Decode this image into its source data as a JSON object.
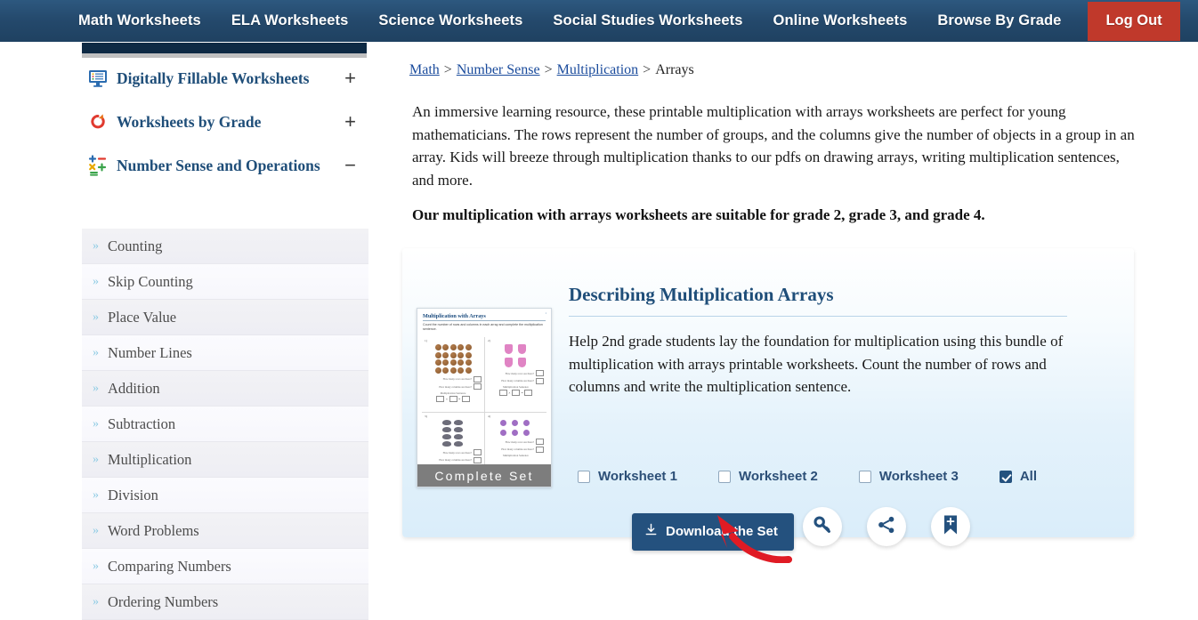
{
  "topnav": {
    "items": [
      {
        "label": "Math Worksheets",
        "name": "nav-math-worksheets"
      },
      {
        "label": "ELA Worksheets",
        "name": "nav-ela-worksheets"
      },
      {
        "label": "Science Worksheets",
        "name": "nav-science-worksheets"
      },
      {
        "label": "Social Studies Worksheets",
        "name": "nav-social-studies-worksheets"
      },
      {
        "label": "Online Worksheets",
        "name": "nav-online-worksheets"
      },
      {
        "label": "Browse By Grade",
        "name": "nav-browse-by-grade"
      }
    ],
    "logout_label": "Log Out",
    "bg_color": "#24496c",
    "logout_color": "#c0392b"
  },
  "sidebar": {
    "categories": [
      {
        "label": "Digitally Fillable Worksheets",
        "toggle": "+",
        "icon": "monitor-worksheet-icon",
        "expanded": false
      },
      {
        "label": "Worksheets by Grade",
        "toggle": "+",
        "icon": "refresh-circle-icon",
        "expanded": false
      },
      {
        "label": "Number Sense and Operations",
        "toggle": "−",
        "icon": "math-operations-icon",
        "expanded": true
      }
    ],
    "items": [
      {
        "label": "Counting"
      },
      {
        "label": "Skip Counting"
      },
      {
        "label": "Place Value"
      },
      {
        "label": "Number Lines"
      },
      {
        "label": "Addition"
      },
      {
        "label": "Subtraction"
      },
      {
        "label": "Multiplication"
      },
      {
        "label": "Division"
      },
      {
        "label": "Word Problems"
      },
      {
        "label": "Comparing Numbers"
      },
      {
        "label": "Ordering Numbers"
      }
    ],
    "bullet": "»",
    "link_color": "#1f4e79"
  },
  "breadcrumb": {
    "items": [
      {
        "label": "Math",
        "link": true
      },
      {
        "label": "Number Sense",
        "link": true
      },
      {
        "label": "Multiplication",
        "link": true
      },
      {
        "label": "Arrays",
        "link": false
      }
    ],
    "separator": ">"
  },
  "main": {
    "intro_paragraph": "An immersive learning resource, these printable multiplication with arrays worksheets are perfect for young mathematicians. The rows represent the number of groups, and the columns give the number of objects in a group in an array. Kids will breeze through multiplication thanks to our pdfs on drawing arrays, writing multiplication sentences, and more.",
    "intro_bold": "Our multiplication with arrays worksheets are suitable for grade 2, grade 3, and grade 4."
  },
  "card": {
    "title": "Describing Multiplication Arrays",
    "description": "Help 2nd grade students lay the foundation for multiplication using this bundle of multiplication with arrays printable worksheets. Count the number of rows and columns and write the multiplication sentence.",
    "thumbnail": {
      "title": "Multiplication with Arrays",
      "instructions": "Count the number of rows and columns in each array and complete the multiplication sentence.",
      "page_number": "1",
      "badge": "Complete Set",
      "questions": [
        {
          "num": "1)",
          "shape": "cookie",
          "rows": 4,
          "cols": 5
        },
        {
          "num": "2)",
          "shape": "dress",
          "rows": 2,
          "cols": 2
        },
        {
          "num": "3)",
          "shape": "hat",
          "rows": 4,
          "cols": 2
        },
        {
          "num": "4)",
          "shape": "lolly",
          "rows": 2,
          "cols": 3
        }
      ],
      "q_line1": "How many rows are there?",
      "q_line2": "How many columns are there?",
      "q_sentence": "Multiplication Sentence",
      "op_times": "×",
      "op_equals": "="
    },
    "checkboxes": [
      {
        "label": "Worksheet 1",
        "checked": false
      },
      {
        "label": "Worksheet 2",
        "checked": false
      },
      {
        "label": "Worksheet 3",
        "checked": false
      },
      {
        "label": "All",
        "checked": true
      }
    ],
    "download_label": "Download the Set",
    "download_icon": "download-icon",
    "action_icons": [
      {
        "name": "key-icon",
        "label": "key"
      },
      {
        "name": "share-icon",
        "label": "share"
      },
      {
        "name": "bookmark-add-icon",
        "label": "bookmark"
      }
    ],
    "accent_color": "#24517e",
    "cursor_color": "#e01b24"
  }
}
